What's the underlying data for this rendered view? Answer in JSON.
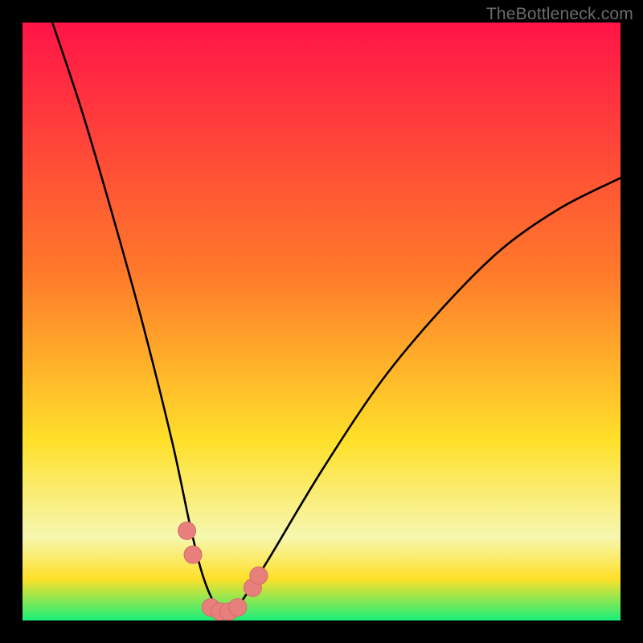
{
  "watermark": "TheBottleneck.com",
  "colors": {
    "frame": "#000000",
    "grad_top": "#ff1447",
    "grad_mid1": "#ff7a2a",
    "grad_mid2": "#ffe02a",
    "grad_band_pale": "#f6f7b0",
    "grad_bottom": "#19ef7b",
    "curve": "#000000",
    "marker_fill": "#e77f7d",
    "marker_stroke": "#d76a66"
  },
  "chart_data": {
    "type": "line",
    "title": "",
    "xlabel": "",
    "ylabel": "",
    "xlim": [
      0,
      100
    ],
    "ylim": [
      0,
      100
    ],
    "series": [
      {
        "name": "bottleneck-curve",
        "x": [
          5,
          10,
          15,
          20,
          25,
          28,
          30,
          32,
          33.5,
          35,
          36.5,
          41,
          50,
          60,
          70,
          80,
          90,
          100
        ],
        "y": [
          100,
          85,
          68,
          50,
          30,
          16,
          8,
          3,
          1.5,
          1.5,
          3,
          10,
          25,
          40,
          52,
          62,
          69,
          74
        ]
      }
    ],
    "markers": [
      {
        "x": 27.5,
        "y": 15
      },
      {
        "x": 28.5,
        "y": 11
      },
      {
        "x": 31.5,
        "y": 2.2
      },
      {
        "x": 33.0,
        "y": 1.5
      },
      {
        "x": 34.5,
        "y": 1.5
      },
      {
        "x": 36.0,
        "y": 2.2
      },
      {
        "x": 38.5,
        "y": 5.5
      },
      {
        "x": 39.5,
        "y": 7.5
      }
    ],
    "gradient_stops": [
      {
        "offset": 0.0,
        "key": "grad_top"
      },
      {
        "offset": 0.42,
        "key": "grad_mid1"
      },
      {
        "offset": 0.7,
        "key": "grad_mid2"
      },
      {
        "offset": 0.86,
        "key": "grad_band_pale"
      },
      {
        "offset": 0.93,
        "key": "grad_mid2"
      },
      {
        "offset": 1.0,
        "key": "grad_bottom"
      }
    ]
  }
}
